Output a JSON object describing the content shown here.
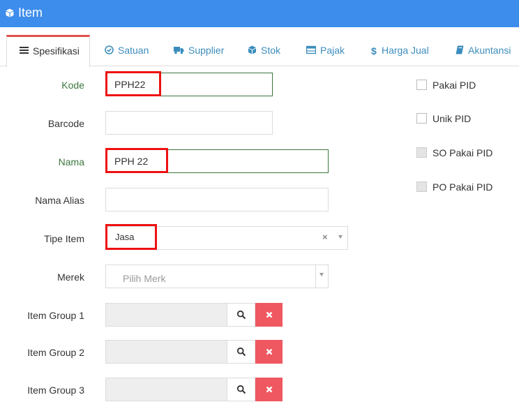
{
  "header": {
    "title": "Item",
    "icon": "cube-icon"
  },
  "tabs": [
    {
      "label": "Spesifikasi",
      "icon": "list-icon",
      "active": true
    },
    {
      "label": "Satuan",
      "icon": "check-circle-icon"
    },
    {
      "label": "Supplier",
      "icon": "truck-icon"
    },
    {
      "label": "Stok",
      "icon": "cube-icon"
    },
    {
      "label": "Pajak",
      "icon": "table-icon"
    },
    {
      "label": "Harga Jual",
      "icon": "dollar-icon"
    },
    {
      "label": "Akuntansi",
      "icon": "book-icon"
    }
  ],
  "form": {
    "kode": {
      "label": "Kode",
      "value": "PPH22"
    },
    "barcode": {
      "label": "Barcode",
      "value": ""
    },
    "nama": {
      "label": "Nama",
      "value": "PPH 22"
    },
    "nama_alias": {
      "label": "Nama Alias",
      "value": ""
    },
    "tipe_item": {
      "label": "Tipe Item",
      "value": "Jasa",
      "clear": "×"
    },
    "merek": {
      "label": "Merek",
      "placeholder": "Pilih Merk"
    },
    "item_group_1": {
      "label": "Item Group 1",
      "value": ""
    },
    "item_group_2": {
      "label": "Item Group 2",
      "value": ""
    },
    "item_group_3": {
      "label": "Item Group 3",
      "value": ""
    }
  },
  "checkboxes": [
    {
      "label": "Pakai PID",
      "checked": false,
      "disabled": false
    },
    {
      "label": "Unik PID",
      "checked": false,
      "disabled": false
    },
    {
      "label": "SO Pakai PID",
      "checked": false,
      "disabled": true
    },
    {
      "label": "PO Pakai PID",
      "checked": false,
      "disabled": true
    }
  ],
  "colors": {
    "header": "#3c8dec",
    "tab_link": "#3c8dbc",
    "active_tab_border": "#e05050",
    "valid_border": "#3c763d",
    "highlight": "#ee1111",
    "delete_button": "#ef5860"
  }
}
